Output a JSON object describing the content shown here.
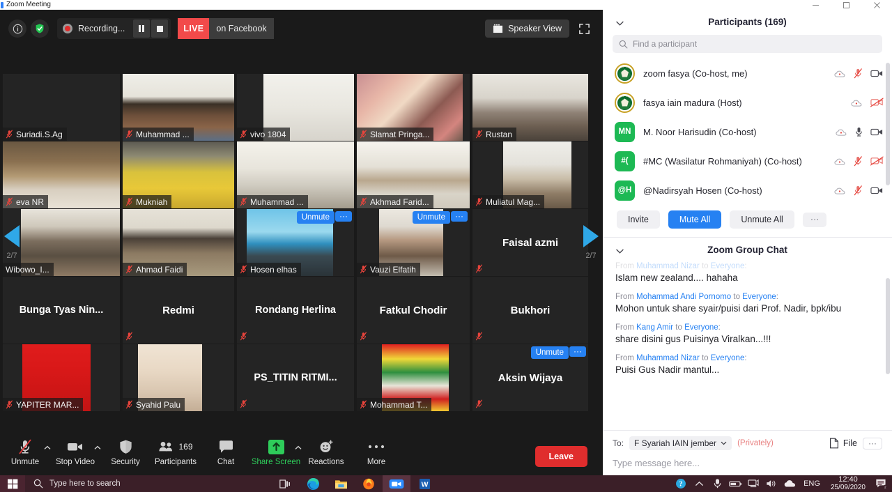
{
  "window": {
    "title": "Zoom Meeting",
    "controls": [
      "minimize-icon",
      "maximize-icon",
      "close-icon"
    ]
  },
  "topbar": {
    "info_icon": "info-icon",
    "shield_icon": "shield-check-icon",
    "recording_label": "Recording...",
    "pause_icon": "pause-icon",
    "stop_icon": "stop-icon",
    "live_badge": "LIVE",
    "live_platform": "on Facebook",
    "view_label": "Speaker View",
    "view_icon": "layout-icon",
    "fullscreen_icon": "fullscreen-icon",
    "colors": {
      "live_red": "#f24a4a",
      "accent_blue": "#2681f2"
    }
  },
  "grid": {
    "page_indicator": "2/7",
    "prev_icon": "chevron-left-arrow-icon",
    "next_icon": "chevron-right-arrow-icon",
    "unmute_label": "Unmute",
    "more_label": "···",
    "rows": [
      {
        "tiles": [
          {
            "name": "Suriadi.S.Ag",
            "muted": true,
            "video": false,
            "style": "dark"
          },
          {
            "name": "Muhammad ...",
            "muted": true,
            "video": true,
            "style": "man-glasses"
          },
          {
            "name": "vivo 1804",
            "muted": true,
            "video": true,
            "style": "narrow-man"
          },
          {
            "name": "Slamat Pringa...",
            "muted": true,
            "video": true,
            "style": "pink-room"
          },
          {
            "name": "Rustan",
            "muted": true,
            "video": true,
            "style": "headphones-man"
          }
        ]
      },
      {
        "tiles": [
          {
            "name": "eva NR",
            "muted": true,
            "video": true,
            "style": "woman-books"
          },
          {
            "name": "Mukniah",
            "muted": true,
            "video": true,
            "style": "yellow-hijab"
          },
          {
            "name": "Muhammad ...",
            "muted": true,
            "video": true,
            "style": "mask-man"
          },
          {
            "name": "Akhmad Farid...",
            "muted": true,
            "video": true,
            "style": "bright-room"
          },
          {
            "name": "Muliatul Mag...",
            "muted": true,
            "video": true,
            "style": "white-hijab"
          }
        ]
      },
      {
        "tiles": [
          {
            "name": "Wibowo_I...",
            "muted": false,
            "video": true,
            "style": "office-man"
          },
          {
            "name": "Ahmad Faidi",
            "muted": true,
            "video": true,
            "style": "songkok-man"
          },
          {
            "name": "Hosen elhas",
            "muted": true,
            "video": true,
            "style": "beach-man",
            "unmute_badge": true
          },
          {
            "name": "Vauzi Elfatih",
            "muted": true,
            "video": true,
            "style": "glasses-man",
            "unmute_badge": true
          },
          {
            "name": "Faisal azmi",
            "muted": true,
            "video": false,
            "style": "name-only"
          }
        ]
      },
      {
        "tiles": [
          {
            "name": "Bunga Tyas Nin...",
            "muted": false,
            "video": false,
            "style": "name-only"
          },
          {
            "name": "Redmi",
            "muted": true,
            "video": false,
            "style": "name-only"
          },
          {
            "name": "Rondang Herlina",
            "muted": true,
            "video": false,
            "style": "name-only"
          },
          {
            "name": "Fatkul Chodir",
            "muted": true,
            "video": false,
            "style": "name-only"
          },
          {
            "name": "Bukhori",
            "muted": true,
            "video": false,
            "style": "name-only"
          }
        ]
      },
      {
        "tiles": [
          {
            "name": "YAPITER MAR...",
            "muted": true,
            "video": true,
            "style": "red-portrait"
          },
          {
            "name": "Syahid Palu",
            "muted": true,
            "video": true,
            "style": "cream-photo"
          },
          {
            "name": "PS_TITIN  RITMI...",
            "muted": true,
            "video": false,
            "style": "name-only"
          },
          {
            "name": "Mohammad T...",
            "muted": true,
            "video": true,
            "style": "poster"
          },
          {
            "name": "Aksin Wijaya",
            "muted": true,
            "video": false,
            "style": "name-only",
            "unmute_badge": true
          }
        ]
      }
    ]
  },
  "toolbar": {
    "items": [
      {
        "label": "Unmute",
        "icon": "mic-muted-icon",
        "caret": true,
        "green": false
      },
      {
        "label": "Stop Video",
        "icon": "video-camera-icon",
        "caret": true,
        "green": false
      },
      {
        "label": "Security",
        "icon": "shield-icon",
        "caret": false,
        "green": false
      },
      {
        "label": "Participants",
        "icon": "people-icon",
        "caret": false,
        "green": false,
        "count": "169"
      },
      {
        "label": "Chat",
        "icon": "chat-bubble-icon",
        "caret": false,
        "green": false
      },
      {
        "label": "Share Screen",
        "icon": "share-screen-icon",
        "caret": true,
        "green": true
      },
      {
        "label": "Reactions",
        "icon": "reactions-smiley-icon",
        "caret": false,
        "green": false
      },
      {
        "label": "More",
        "icon": "more-dots-icon",
        "caret": false,
        "green": false
      }
    ],
    "leave_label": "Leave"
  },
  "participants_panel": {
    "title": "Participants (169)",
    "collapse_icon": "chevron-down-icon",
    "search": {
      "placeholder": "Find a participant",
      "icon": "search-icon"
    },
    "rows": [
      {
        "avatar_type": "logo",
        "initials": "",
        "name": "zoom fasya (Co-host, me)",
        "cloud": true,
        "mic": "muted",
        "video": "on"
      },
      {
        "avatar_type": "logo",
        "initials": "",
        "name": "fasya iain madura (Host)",
        "cloud": true,
        "mic": "none",
        "video": "off"
      },
      {
        "avatar_type": "initials",
        "initials": "MN",
        "name": "M. Noor Harisudin (Co-host)",
        "cloud": true,
        "mic": "on",
        "video": "on"
      },
      {
        "avatar_type": "initials",
        "initials": "#(",
        "name": "#MC (Wasilatur Rohmaniyah) (Co-host)",
        "cloud": true,
        "mic": "muted",
        "video": "off"
      },
      {
        "avatar_type": "initials",
        "initials": "@H",
        "name": "@Nadirsyah Hosen (Co-host)",
        "cloud": true,
        "mic": "muted",
        "video": "on"
      }
    ],
    "actions": [
      {
        "label": "Invite",
        "primary": false
      },
      {
        "label": "Mute All",
        "primary": true
      },
      {
        "label": "Unmute All",
        "primary": false
      },
      {
        "label": "···",
        "primary": false,
        "more": true
      }
    ]
  },
  "chat_panel": {
    "title": "Zoom Group Chat",
    "collapse_icon": "chevron-down-icon",
    "messages": [
      {
        "from": "Muhammad Nizar",
        "to": "Everyone",
        "prefix": "From",
        "linker": "to",
        "text": "Islam new zealand.... hahaha",
        "clipped": true
      },
      {
        "from": "Mohammad Andi Pornomo",
        "to": "Everyone",
        "prefix": "From",
        "linker": "to",
        "text": "Mohon untuk share syair/puisi dari Prof. Nadir, bpk/ibu",
        "clipped": false
      },
      {
        "from": "Kang Amir",
        "to": "Everyone",
        "prefix": "From",
        "linker": "to",
        "text": "share disini gus Puisinya Viralkan...!!!",
        "clipped": false
      },
      {
        "from": "Muhammad Nizar",
        "to": "Everyone",
        "prefix": "From",
        "linker": "to",
        "text": "Puisi Gus Nadir mantul...",
        "clipped": false
      }
    ],
    "footer": {
      "to_label": "To:",
      "recipient": "F Syariah IAIN jember",
      "recipient_caret": "chevron-down-icon",
      "privately": "(Privately)",
      "file_label": "File",
      "file_icon": "file-icon",
      "more_label": "···",
      "input_placeholder": "Type message here..."
    }
  },
  "taskbar": {
    "start_icon": "windows-start-icon",
    "search_placeholder": "Type here to search",
    "search_icon": "search-icon",
    "apps": [
      {
        "name": "task-view-icon"
      },
      {
        "name": "edge-browser-icon"
      },
      {
        "name": "file-explorer-icon"
      },
      {
        "name": "firefox-icon"
      },
      {
        "name": "zoom-app-icon"
      },
      {
        "name": "word-app-icon"
      }
    ],
    "tray": [
      {
        "name": "help-circle-icon"
      },
      {
        "name": "show-hidden-icons-icon"
      },
      {
        "name": "microphone-icon"
      },
      {
        "name": "battery-icon"
      },
      {
        "name": "network-icon"
      },
      {
        "name": "volume-icon"
      },
      {
        "name": "onedrive-icon"
      }
    ],
    "language": "ENG",
    "clock_time": "12:40",
    "clock_date": "25/09/2020",
    "notification_icon": "notifications-icon"
  }
}
